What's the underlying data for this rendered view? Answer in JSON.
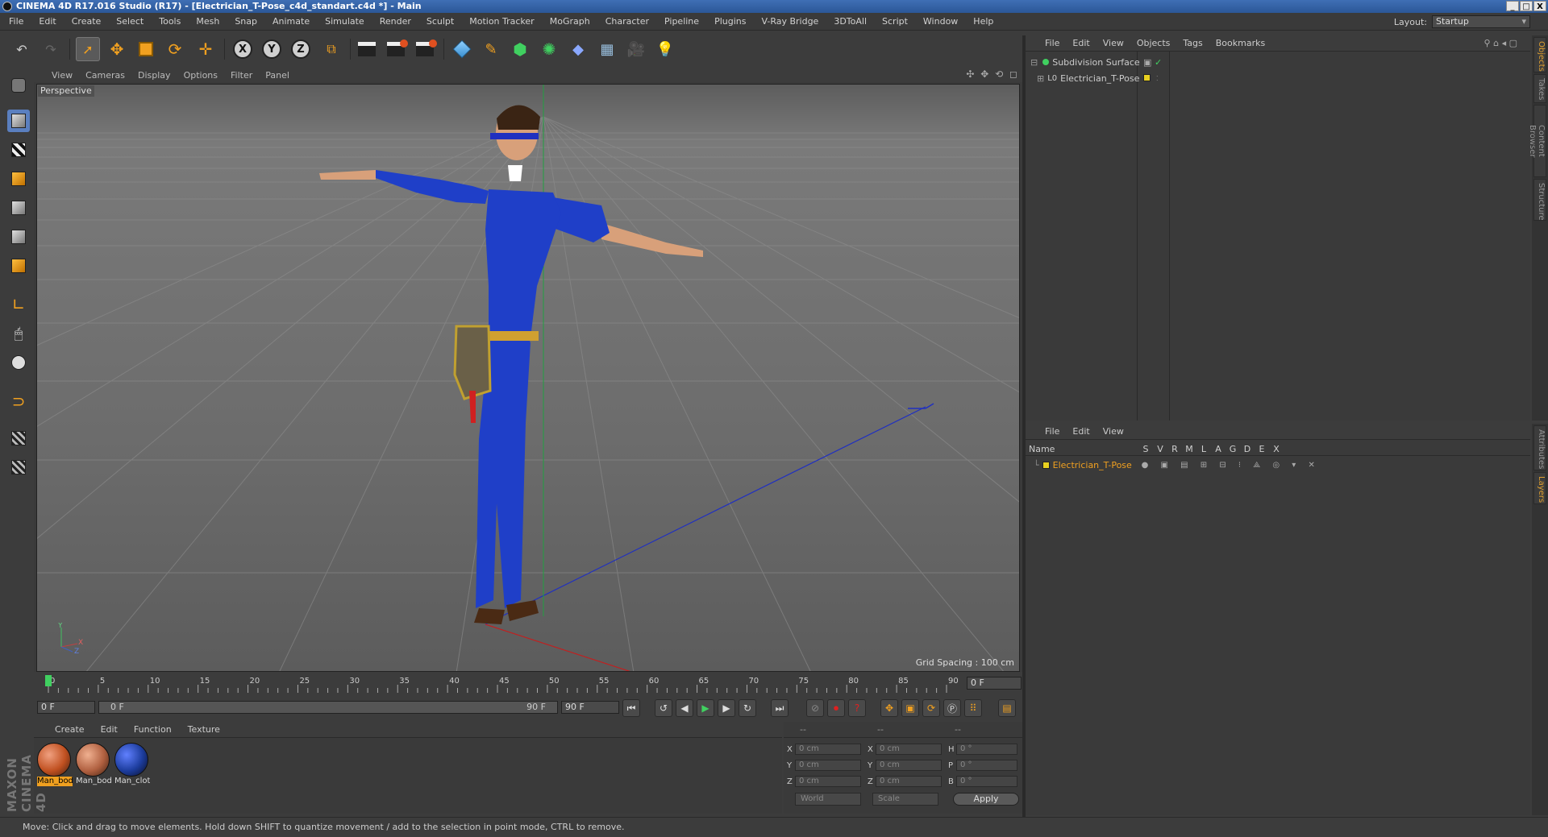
{
  "app": {
    "title": "CINEMA 4D R17.016 Studio (R17) - [Electrician_T-Pose_c4d_standart.c4d *] - Main",
    "window_buttons": [
      "_",
      "□",
      "X"
    ]
  },
  "menubar": {
    "items": [
      "File",
      "Edit",
      "Create",
      "Select",
      "Tools",
      "Mesh",
      "Snap",
      "Animate",
      "Simulate",
      "Render",
      "Sculpt",
      "Motion Tracker",
      "MoGraph",
      "Character",
      "Pipeline",
      "Plugins",
      "V-Ray Bridge",
      "3DToAll",
      "Script",
      "Window",
      "Help"
    ],
    "layout_label": "Layout:",
    "layout_value": "Startup"
  },
  "toolbar": {
    "axis_x": "X",
    "axis_y": "Y",
    "axis_z": "Z",
    "icons": [
      "undo-icon",
      "redo-icon",
      "live-selection-icon",
      "move-icon",
      "scale-icon",
      "rotate-icon",
      "recent-tool-icon",
      "x-axis-icon",
      "y-axis-icon",
      "z-axis-icon",
      "coordinate-system-icon",
      "render-view-icon",
      "render-picture-viewer-icon",
      "edit-render-settings-icon",
      "cube-icon",
      "pen-icon",
      "subdivision-icon",
      "array-icon",
      "deformer-icon",
      "floor-icon",
      "camera-icon",
      "light-icon"
    ]
  },
  "viewport": {
    "menu": [
      "View",
      "Cameras",
      "Display",
      "Options",
      "Filter",
      "Panel"
    ],
    "label": "Perspective",
    "grid_spacing": "Grid Spacing : 100 cm",
    "nav_icons": "✣ ✥ ⟲ ◻",
    "axis_y": "Y",
    "axis_x": "X",
    "axis_z": "Z"
  },
  "timeline": {
    "ticks": [
      "0",
      "5",
      "10",
      "15",
      "20",
      "25",
      "30",
      "35",
      "40",
      "45",
      "50",
      "55",
      "60",
      "65",
      "70",
      "75",
      "80",
      "85",
      "90"
    ],
    "current_frame": "0 F"
  },
  "transport": {
    "start": "0 F",
    "range_start": "0 F",
    "range_end": "90 F",
    "end": "90 F"
  },
  "materials": {
    "menu": [
      "Create",
      "Edit",
      "Function",
      "Texture"
    ],
    "items": [
      {
        "label": "Man_bod",
        "selected": true,
        "color": "#c05020"
      },
      {
        "label": "Man_bod",
        "selected": false,
        "color": "#b06040"
      },
      {
        "label": "Man_clot",
        "selected": false,
        "color": "#1c3c9c"
      }
    ]
  },
  "coords": {
    "header": [
      "--",
      "--",
      "--"
    ],
    "rows": [
      {
        "a": "X",
        "av": "0 cm",
        "b": "X",
        "bv": "0 cm",
        "c": "H",
        "cv": "0 °"
      },
      {
        "a": "Y",
        "av": "0 cm",
        "b": "Y",
        "bv": "0 cm",
        "c": "P",
        "cv": "0 °"
      },
      {
        "a": "Z",
        "av": "0 cm",
        "b": "Z",
        "bv": "0 cm",
        "c": "B",
        "cv": "0 °"
      }
    ],
    "world": "World",
    "scale": "Scale",
    "apply": "Apply"
  },
  "object_manager": {
    "menu": [
      "File",
      "Edit",
      "View",
      "Objects",
      "Tags",
      "Bookmarks"
    ],
    "objects": [
      {
        "name": "Subdivision Surface"
      },
      {
        "name": "Electrician_T-Pose"
      }
    ]
  },
  "layer_manager": {
    "menu": [
      "File",
      "Edit",
      "View"
    ],
    "name_header": "Name",
    "columns": [
      "S",
      "V",
      "R",
      "M",
      "L",
      "A",
      "G",
      "D",
      "E",
      "X"
    ],
    "layers": [
      {
        "name": "Electrician_T-Pose",
        "color": "#e8d020"
      }
    ]
  },
  "side_tabs_top": [
    "Objects",
    "Takes",
    "Content Browser",
    "Structure"
  ],
  "side_tabs_bottom": [
    "Attributes",
    "Layers"
  ],
  "status": "Move: Click and drag to move elements. Hold down SHIFT to quantize movement / add to the selection in point mode, CTRL to remove.",
  "brand": "MAXON CINEMA 4D",
  "colors": {
    "accent_orange": "#f0a020",
    "selection_blue": "#5a7fbf",
    "overall_blue": "#1f3fc8"
  }
}
